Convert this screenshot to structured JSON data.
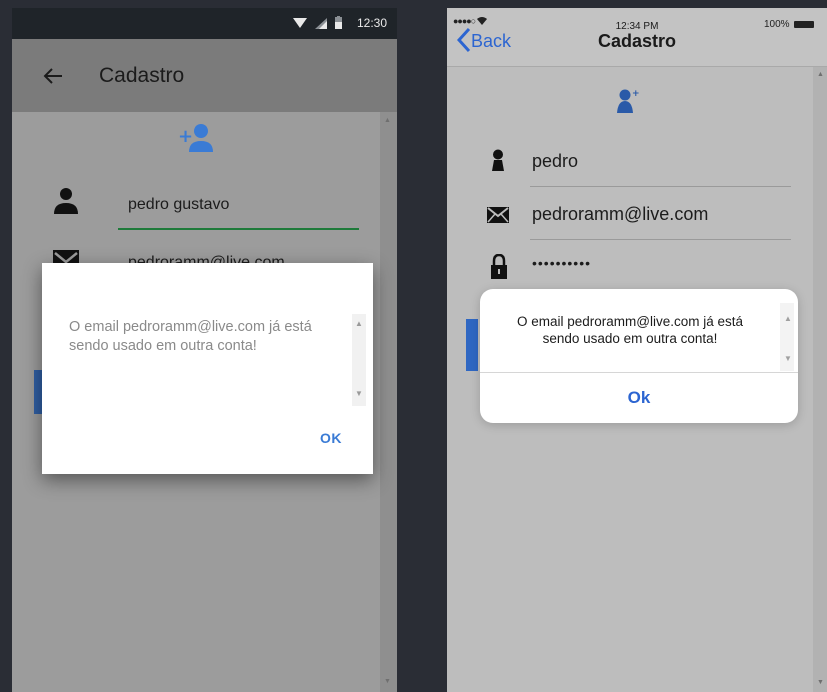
{
  "android": {
    "status_time": "12:30",
    "app_title": "Cadastro",
    "name_value": "pedro gustavo",
    "email_value": "pedroramm@live.com",
    "dialog": {
      "message": "O email pedroramm@live.com já está sendo usado em outra conta!",
      "ok_label": "OK"
    }
  },
  "ios": {
    "status_time": "12:34 PM",
    "signal": "●●●●○",
    "battery": "100%",
    "back_label": "Back",
    "title": "Cadastro",
    "name_value": "pedro",
    "email_value": "pedroramm@live.com",
    "password_value": "••••••••••",
    "dialog": {
      "message": "O email pedroramm@live.com já está sendo usado em outra conta!",
      "ok_label": "Ok"
    }
  },
  "colors": {
    "android_accent_underline": "#1e7a3a",
    "ok_blue": "#3a7bd5",
    "ios_blue": "#2c65d1"
  },
  "icons": [
    "wifi-icon",
    "cell-signal-icon",
    "battery-icon",
    "back-arrow-icon",
    "add-user-icon",
    "person-icon",
    "envelope-icon",
    "lock-icon",
    "scroll-up-icon",
    "scroll-down-icon",
    "back-chevron-icon"
  ]
}
